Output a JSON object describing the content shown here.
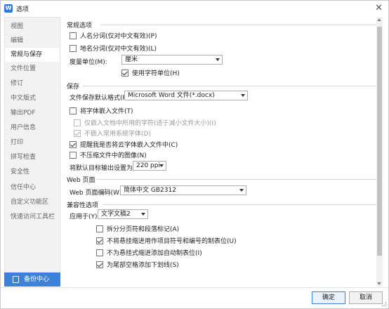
{
  "window": {
    "title": "选项",
    "app_icon_letter": "W"
  },
  "sidebar": {
    "items": [
      {
        "label": "视图"
      },
      {
        "label": "编辑"
      },
      {
        "label": "常规与保存",
        "active": true
      },
      {
        "label": "文件位置"
      },
      {
        "label": "修订"
      },
      {
        "label": "中文版式"
      },
      {
        "label": "输出PDF"
      },
      {
        "label": "用户信息"
      },
      {
        "label": "打印"
      },
      {
        "label": "拼写检查"
      },
      {
        "label": "安全性"
      },
      {
        "label": "信任中心"
      },
      {
        "label": "自定义功能区"
      },
      {
        "label": "快速访问工具栏"
      }
    ],
    "backup_label": "备份中心"
  },
  "general": {
    "title": "常规选项",
    "person_name": {
      "label": "人名分词(仅对中文有效)(P)",
      "checked": false
    },
    "place_name": {
      "label": "地名分词(仅对中文有效)(L)",
      "checked": false
    },
    "measure_unit_label": "度量单位(M):",
    "measure_unit_value": "厘米",
    "char_unit": {
      "label": "使用字符单位(H)",
      "checked": true
    }
  },
  "save": {
    "title": "保存",
    "default_format_label": "文件保存默认格式(F):",
    "default_format_value": "Microsoft Word 文件(*.docx)",
    "embed_fonts": {
      "label": "将字体嵌入文件(T)",
      "checked": false
    },
    "embed_used_only": {
      "label": "仅嵌入文档中所用的字符(适于减小文件大小)(I)",
      "checked": false,
      "disabled": true
    },
    "no_common_fonts": {
      "label": "不嵌入常用系统字体(D)",
      "checked": true,
      "disabled": true
    },
    "remind_cloud_fonts": {
      "label": "提醒我是否将云字体嵌入文件中(C)",
      "checked": true
    },
    "no_compress_images": {
      "label": "不压缩文件中的图像(N)",
      "checked": false
    },
    "target_output_label": "将默认目标输出设置为(P):",
    "target_output_value": "220 ppi"
  },
  "web": {
    "title": "Web 页面",
    "encoding_label": "Web 页面编码(W):",
    "encoding_value": "简体中文 GB2312"
  },
  "compat": {
    "title": "兼容性选项",
    "apply_to_label": "应用于(Y):",
    "apply_to_value": "文字文稿2",
    "split_page_breaks": {
      "label": "拆分分页符和段落标记(A)",
      "checked": false
    },
    "no_hanging_indent_tabs": {
      "label": "不将悬挂缩进用作项目符号和编号的制表位(U)",
      "checked": true
    },
    "no_auto_tab_hanging": {
      "label": "不为悬挂式缩进添加自动制表位(I)",
      "checked": false
    },
    "underline_trailing_spaces": {
      "label": "为尾部空格添加下划线(S)",
      "checked": true
    }
  },
  "buttons": {
    "ok": "确定",
    "cancel": "取消"
  }
}
